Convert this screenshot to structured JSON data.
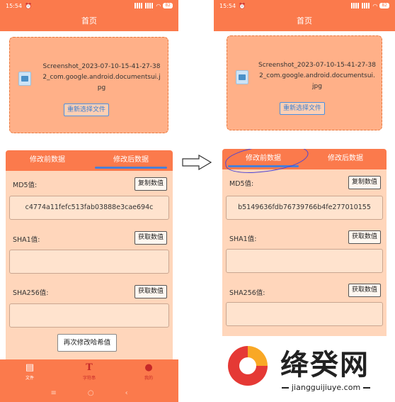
{
  "colors": {
    "accent": "#fb7a4c",
    "panel": "#ffd6bb",
    "link": "#3a7fd0",
    "highlight": "#4a43d8"
  },
  "left": {
    "status": {
      "time": "15:54",
      "battery": "82"
    },
    "title": "首页",
    "file_name": "Screenshot_2023-07-10-15-41-27-382_com.google.android.documentsui.jpg",
    "rechoose_label": "重新选择文件",
    "tabs": [
      {
        "label": "修改前数据"
      },
      {
        "label": "修改后数据"
      }
    ],
    "md5": {
      "label": "MD5值:",
      "button": "复制数值",
      "value": "c4774a11fefc513fab03888e3cae694c"
    },
    "sha1": {
      "label": "SHA1值:",
      "button": "获取数值",
      "value": ""
    },
    "sha256": {
      "label": "SHA256值:",
      "button": "获取数值",
      "value": ""
    },
    "again_button": "再次修改哈希值",
    "tabbar": [
      {
        "label": "文件",
        "icon": "file-icon"
      },
      {
        "label": "字符串",
        "icon": "text-icon"
      },
      {
        "label": "我的",
        "icon": "user-icon"
      }
    ],
    "nav": [
      "≡",
      "○",
      "‹"
    ]
  },
  "right": {
    "status": {
      "time": "15:54",
      "battery": "82"
    },
    "title": "首页",
    "file_name": "Screenshot_2023-07-10-15-41-27-382_com.google.android.documentsui.jpg",
    "rechoose_label": "重新选择文件",
    "tabs": [
      {
        "label": "修改前数据"
      },
      {
        "label": "修改后数据"
      }
    ],
    "md5": {
      "label": "MD5值:",
      "button": "复制数值",
      "value": "b5149636fdb76739766b4fe277010155"
    },
    "sha1": {
      "label": "SHA1值:",
      "button": "获取数值",
      "value": ""
    },
    "sha256": {
      "label": "SHA256值:",
      "button": "获取数值",
      "value": ""
    }
  },
  "watermark": {
    "brand": "绛癸网",
    "domain": "jiangguijiuye.com"
  }
}
